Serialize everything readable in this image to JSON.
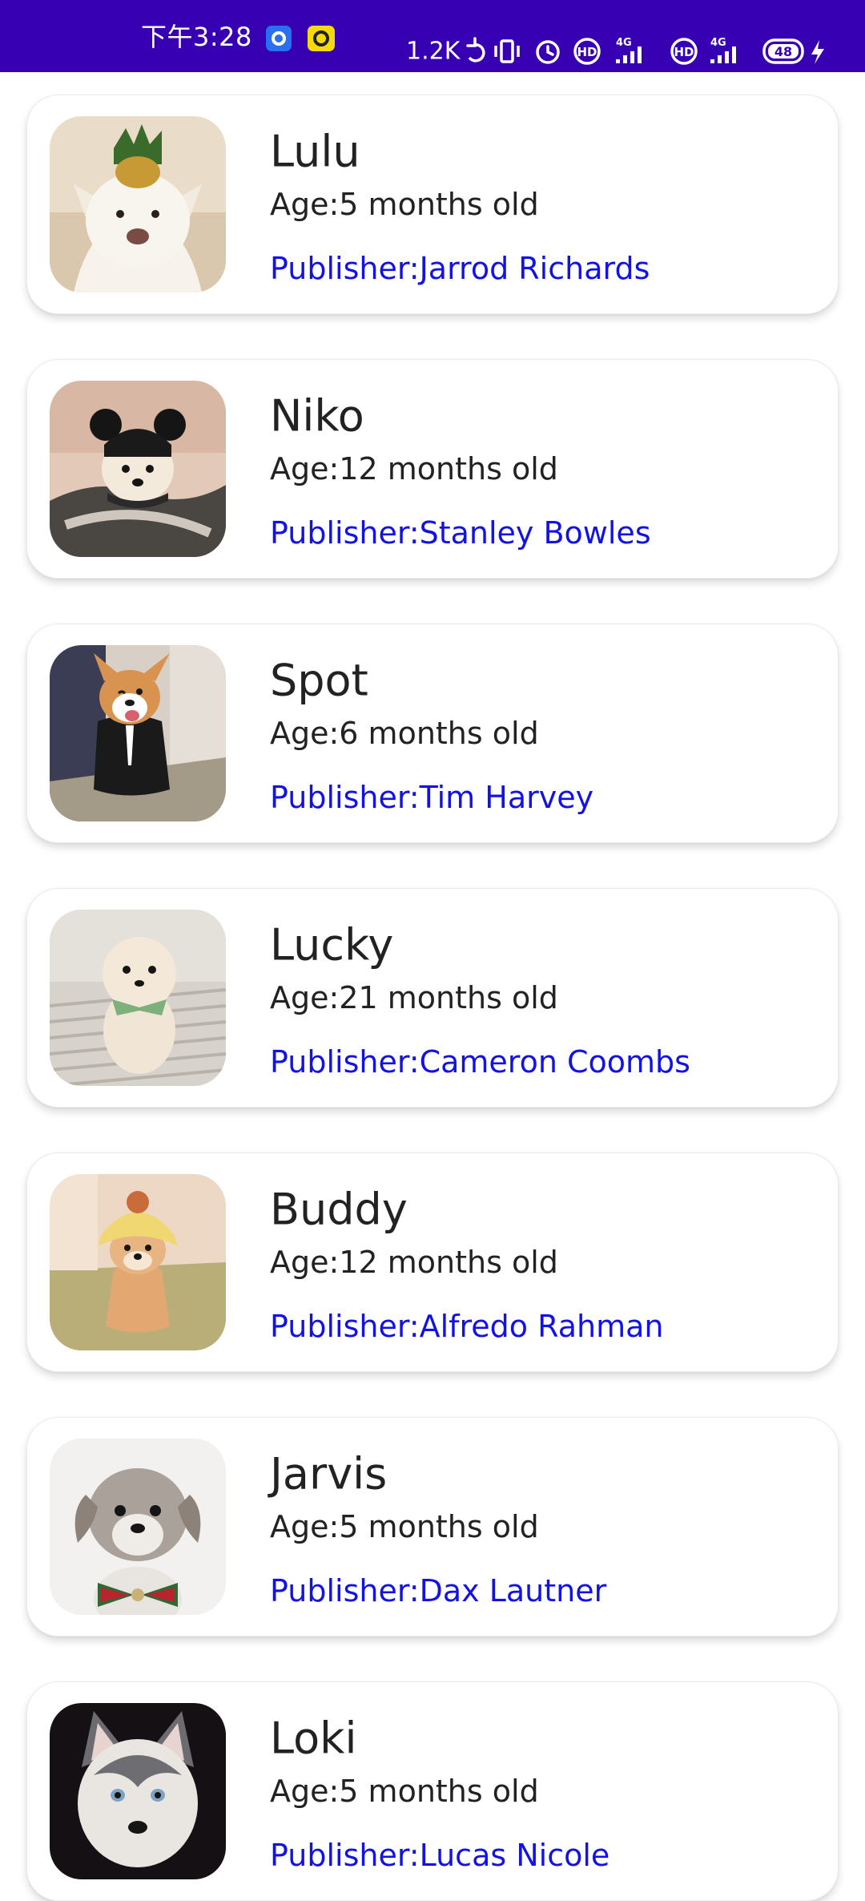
{
  "status_bar": {
    "time": "下午3:28",
    "network_speed": "1.2K",
    "battery_level": "48",
    "network_type_1": "4G",
    "network_type_2": "4G",
    "hd_label": "HD",
    "background_color": "#3700b3"
  },
  "colors": {
    "publisher_text": "#1212e6",
    "primary_text": "#222222"
  },
  "dogs": [
    {
      "name": "Lulu",
      "age": "Age:5 months old",
      "publisher": "Publisher:Jarrod Richards"
    },
    {
      "name": "Niko",
      "age": "Age:12 months old",
      "publisher": "Publisher:Stanley Bowles"
    },
    {
      "name": "Spot",
      "age": "Age:6 months old",
      "publisher": "Publisher:Tim Harvey"
    },
    {
      "name": "Lucky",
      "age": "Age:21 months old",
      "publisher": "Publisher:Cameron Coombs"
    },
    {
      "name": "Buddy",
      "age": "Age:12 months old",
      "publisher": "Publisher:Alfredo Rahman"
    },
    {
      "name": "Jarvis",
      "age": "Age:5 months old",
      "publisher": "Publisher:Dax Lautner"
    },
    {
      "name": "Loki",
      "age": "Age:5 months old",
      "publisher": "Publisher:Lucas Nicole"
    }
  ]
}
